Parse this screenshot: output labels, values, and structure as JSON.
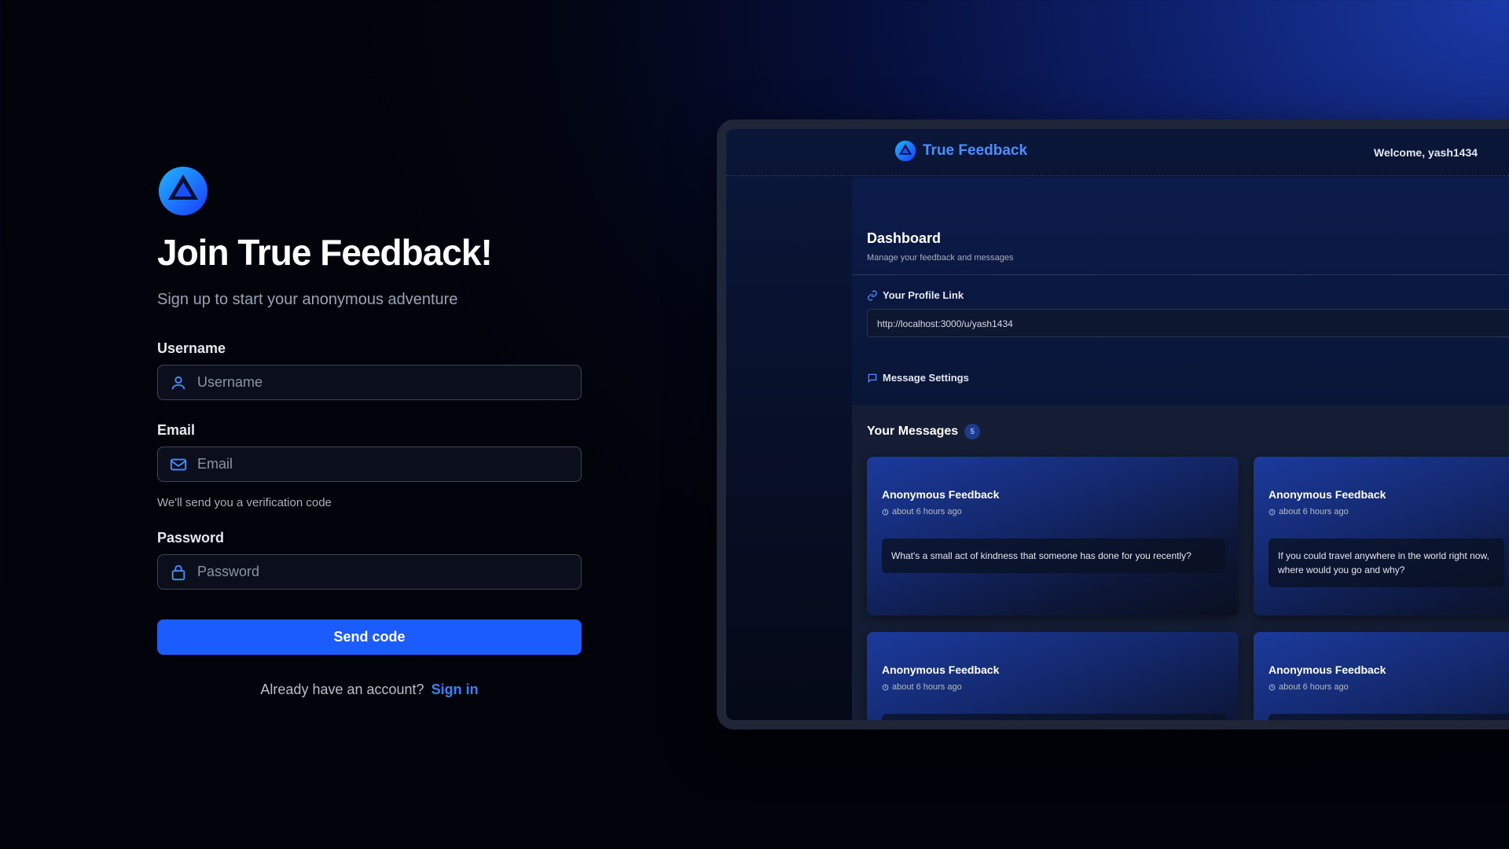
{
  "signup": {
    "title": "Join True Feedback!",
    "subtitle": "Sign up to start your anonymous adventure",
    "username_label": "Username",
    "username_placeholder": "Username",
    "email_label": "Email",
    "email_placeholder": "Email",
    "email_hint": "We'll send you a verification code",
    "password_label": "Password",
    "password_placeholder": "Password",
    "submit_label": "Send code",
    "signin_prompt": "Already have an account?",
    "signin_link": "Sign in"
  },
  "preview": {
    "brand": "True Feedback",
    "welcome": "Welcome, yash1434",
    "dashboard_title": "Dashboard",
    "dashboard_subtitle": "Manage your feedback and messages",
    "profile_link_label": "Your Profile Link",
    "profile_link_value": "http://localhost:3000/u/yash1434",
    "message_settings_label": "Message Settings",
    "messages_title": "Your Messages",
    "messages_count": "5",
    "cards": [
      {
        "title": "Anonymous Feedback",
        "time": "about 6 hours ago",
        "body": "What's a small act of kindness that someone has done for you recently?"
      },
      {
        "title": "Anonymous Feedback",
        "time": "about 6 hours ago",
        "body": "If you could travel anywhere in the world right now, where would you go and why?"
      },
      {
        "title": "Anonymous Feedback",
        "time": "about 6 hours ago",
        "body": ""
      },
      {
        "title": "Anonymous Feedback",
        "time": "about 6 hours ago",
        "body": ""
      }
    ]
  },
  "colors": {
    "accent": "#1a5cff",
    "link": "#3b82f6",
    "brand": "#4a8fff"
  },
  "icons": [
    "logo-icon",
    "user-icon",
    "mail-icon",
    "lock-icon",
    "link-icon",
    "message-icon",
    "clock-icon"
  ]
}
